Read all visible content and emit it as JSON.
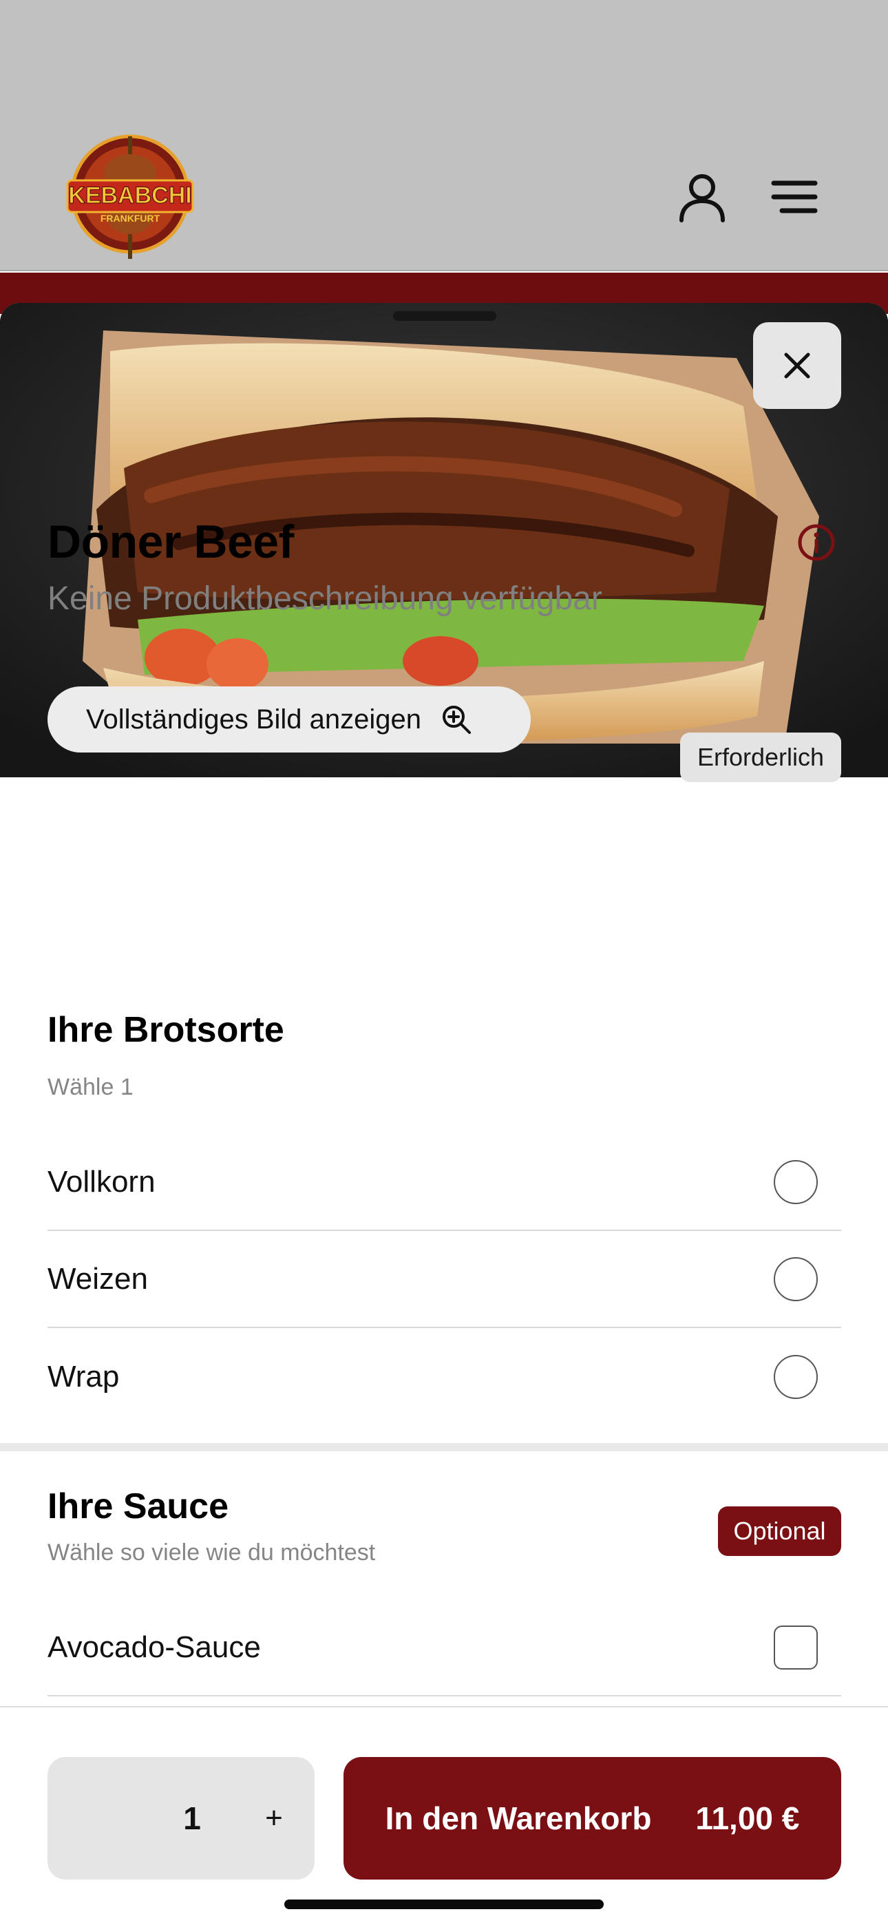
{
  "header": {
    "logo": {
      "wordmark": "KEBABCHI",
      "city": "FRANKFURT",
      "icon": "kebab-logo-icon"
    },
    "profile_icon": "person-icon",
    "menu_icon": "hamburger-menu-icon"
  },
  "product": {
    "close_icon": "close-icon",
    "view_image_label": "Vollständiges Bild anzeigen",
    "view_image_icon": "zoom-in-icon",
    "title": "Döner Beef",
    "description": "Keine Produktbeschreibung verfügbar",
    "info_icon": "info-icon"
  },
  "bread": {
    "title": "Ihre Brotsorte",
    "hint": "Wähle 1",
    "badge": "Erforderlich",
    "options": [
      {
        "label": "Vollkorn"
      },
      {
        "label": "Weizen"
      },
      {
        "label": "Wrap"
      }
    ]
  },
  "sauce": {
    "title": "Ihre Sauce",
    "hint": "Wähle so viele wie du möchtest",
    "badge": "Optional",
    "options": [
      {
        "label": "Avocado-Sauce"
      }
    ]
  },
  "footer": {
    "quantity": "1",
    "plus_label": "+",
    "cart_label": "In den Warenkorb",
    "price": "11,00 €"
  },
  "colors": {
    "brand": "#7b1014",
    "header_bg": "#c1c1c1",
    "muted_text": "#808080"
  }
}
